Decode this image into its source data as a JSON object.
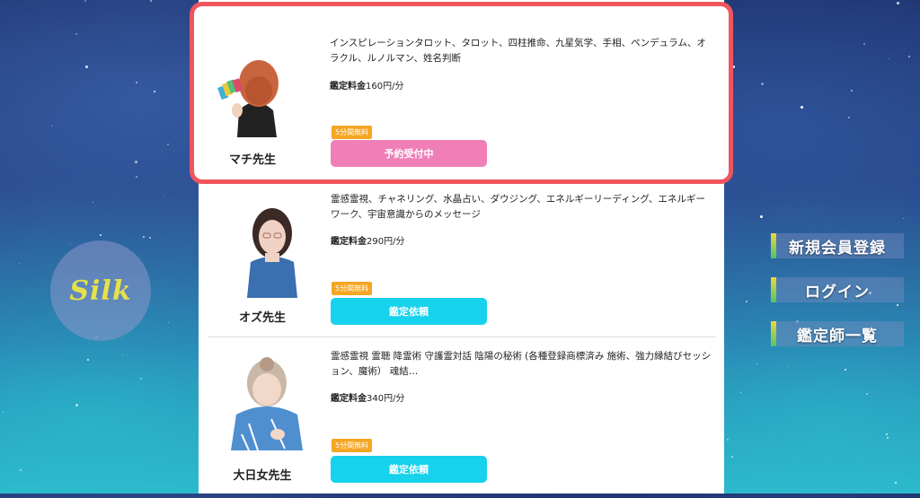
{
  "logo": {
    "text": "Silk"
  },
  "nav": {
    "items": [
      {
        "label": "新規会員登録"
      },
      {
        "label": "ログイン"
      },
      {
        "label": "鑑定師一覧"
      }
    ]
  },
  "fortune_tellers": [
    {
      "name": "マチ先生",
      "description": "インスピレーションタロット、タロット、四柱推命、九星気学、手相、ペンデュラム、オラクル、ルノルマン、姓名判断",
      "fee_label": "鑑定料金",
      "fee_value": "160円/分",
      "badge": "5分間無料",
      "button": "予約受付中"
    },
    {
      "name": "オズ先生",
      "description": "霊感霊視、チャネリング、水晶占い、ダウジング、エネルギーリーディング、エネルギーワーク、宇宙意識からのメッセージ",
      "fee_label": "鑑定料金",
      "fee_value": "290円/分",
      "badge": "5分間無料",
      "button": "鑑定依頼"
    },
    {
      "name": "大日女先生",
      "description": "霊感霊視 霊聴 降霊術 守護霊対話 陰陽の秘術 (各種登録商標済み 施術、強力縁結びセッション、魔術） 魂結…",
      "fee_label": "鑑定料金",
      "fee_value": "340円/分",
      "badge": "5分間無料",
      "button": "鑑定依頼"
    }
  ],
  "colors": {
    "highlight_border": "#f0555e",
    "pink_button": "#f07fb8",
    "cyan_button": "#16d2ec",
    "badge": "#f5a623"
  }
}
